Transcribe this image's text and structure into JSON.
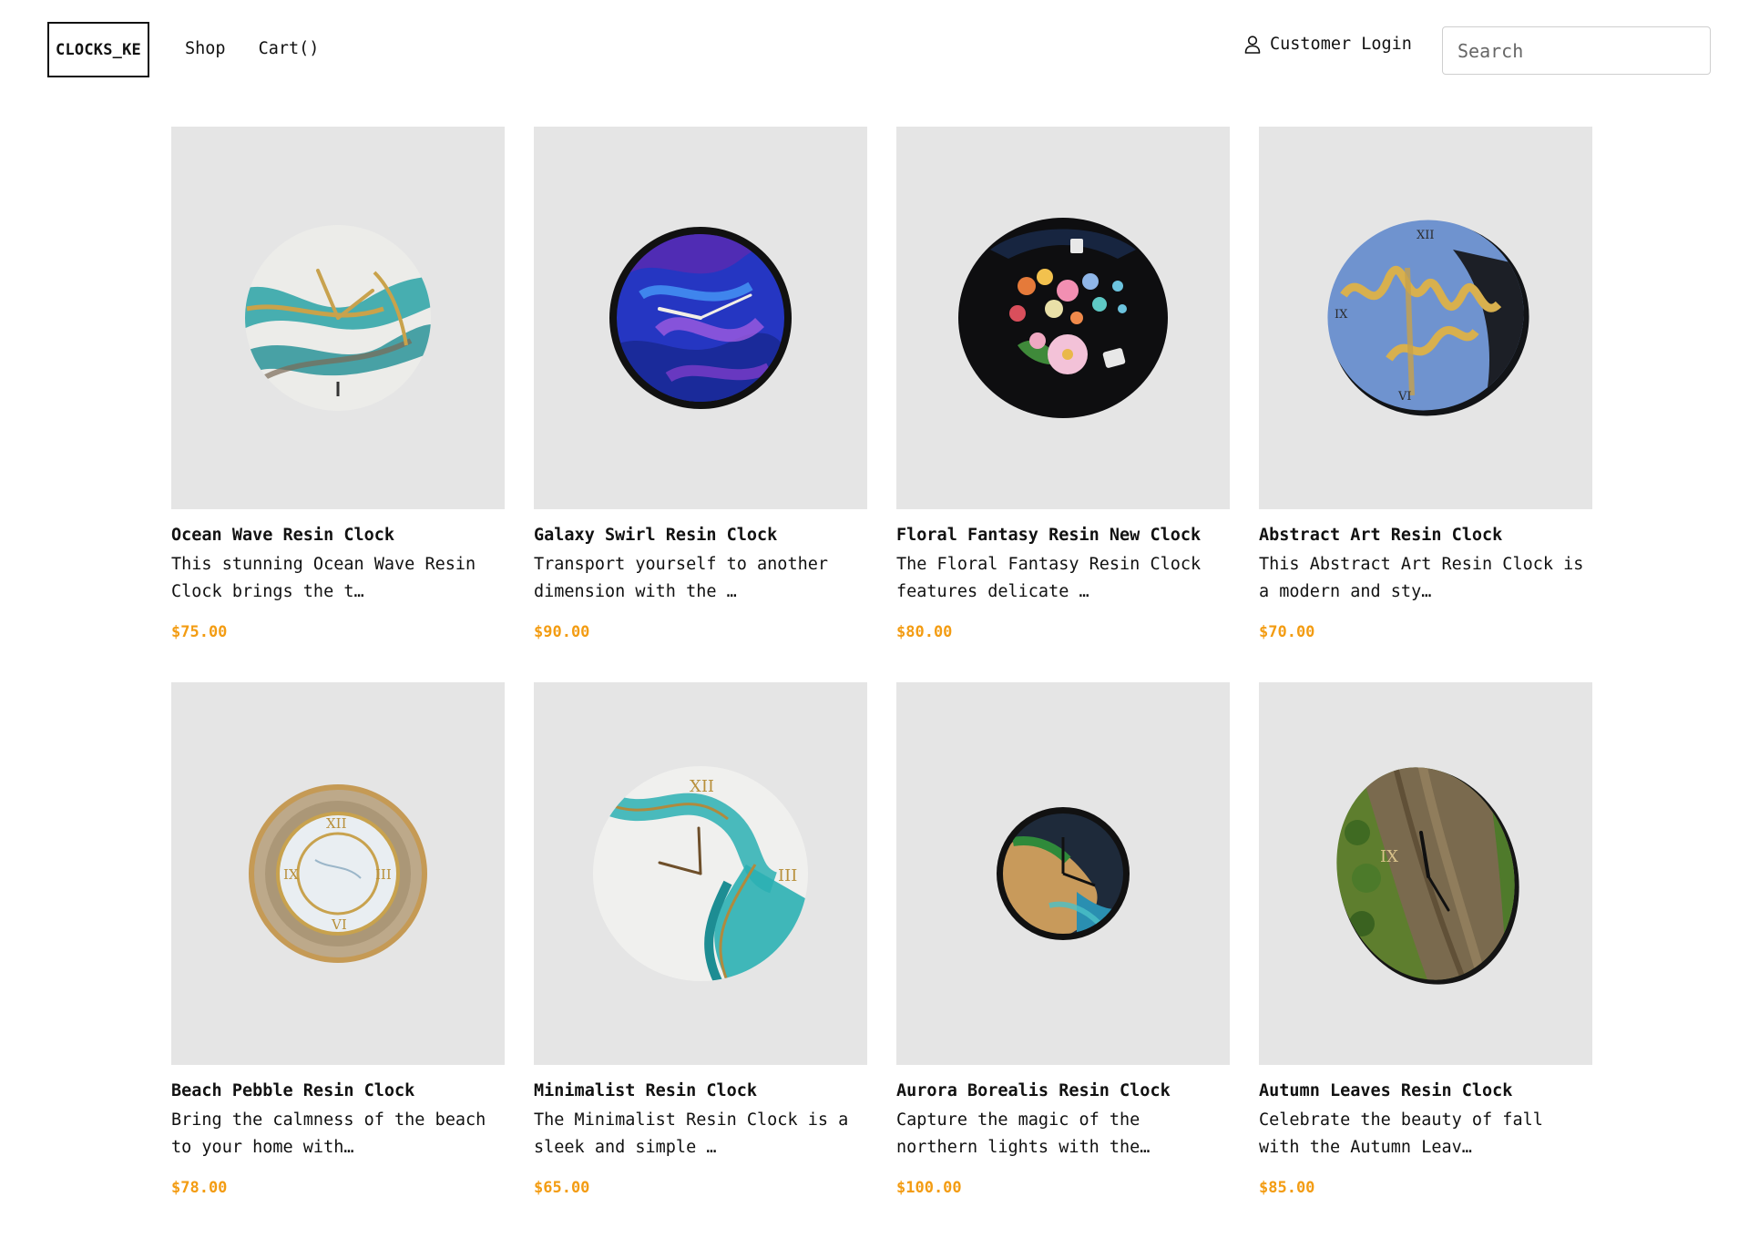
{
  "header": {
    "logo": "CLOCKS_KE",
    "nav": [
      {
        "label": "Shop"
      },
      {
        "label": "Cart()"
      }
    ],
    "login_label": "Customer Login",
    "login_icon": "user-icon",
    "search_placeholder": "Search"
  },
  "colors": {
    "price": "#f39c12",
    "thumb_bg": "#e5e5e5"
  },
  "products": [
    {
      "name": "Ocean Wave Resin Clock",
      "desc": "This stunning Ocean Wave Resin Clock brings the t…",
      "price": "$75.00",
      "image": "ocean-wave-clock-image"
    },
    {
      "name": "Galaxy Swirl Resin Clock",
      "desc": "Transport yourself to another dimension with the …",
      "price": "$90.00",
      "image": "galaxy-swirl-clock-image"
    },
    {
      "name": "Floral Fantasy Resin New Clock",
      "desc": "The Floral Fantasy Resin Clock features delicate …",
      "price": "$80.00",
      "image": "floral-fantasy-clock-image"
    },
    {
      "name": "Abstract Art Resin Clock",
      "desc": "This Abstract Art Resin Clock is a modern and sty…",
      "price": "$70.00",
      "image": "abstract-art-clock-image"
    },
    {
      "name": "Beach Pebble Resin Clock",
      "desc": "Bring the calmness of the beach to your home with…",
      "price": "$78.00",
      "image": "beach-pebble-clock-image"
    },
    {
      "name": "Minimalist Resin Clock",
      "desc": "The Minimalist Resin Clock is a sleek and simple …",
      "price": "$65.00",
      "image": "minimalist-clock-image"
    },
    {
      "name": "Aurora Borealis Resin Clock",
      "desc": "Capture the magic of the northern lights with the…",
      "price": "$100.00",
      "image": "aurora-borealis-clock-image"
    },
    {
      "name": "Autumn Leaves Resin Clock",
      "desc": "Celebrate the beauty of fall with the Autumn Leav…",
      "price": "$85.00",
      "image": "autumn-leaves-clock-image"
    }
  ]
}
